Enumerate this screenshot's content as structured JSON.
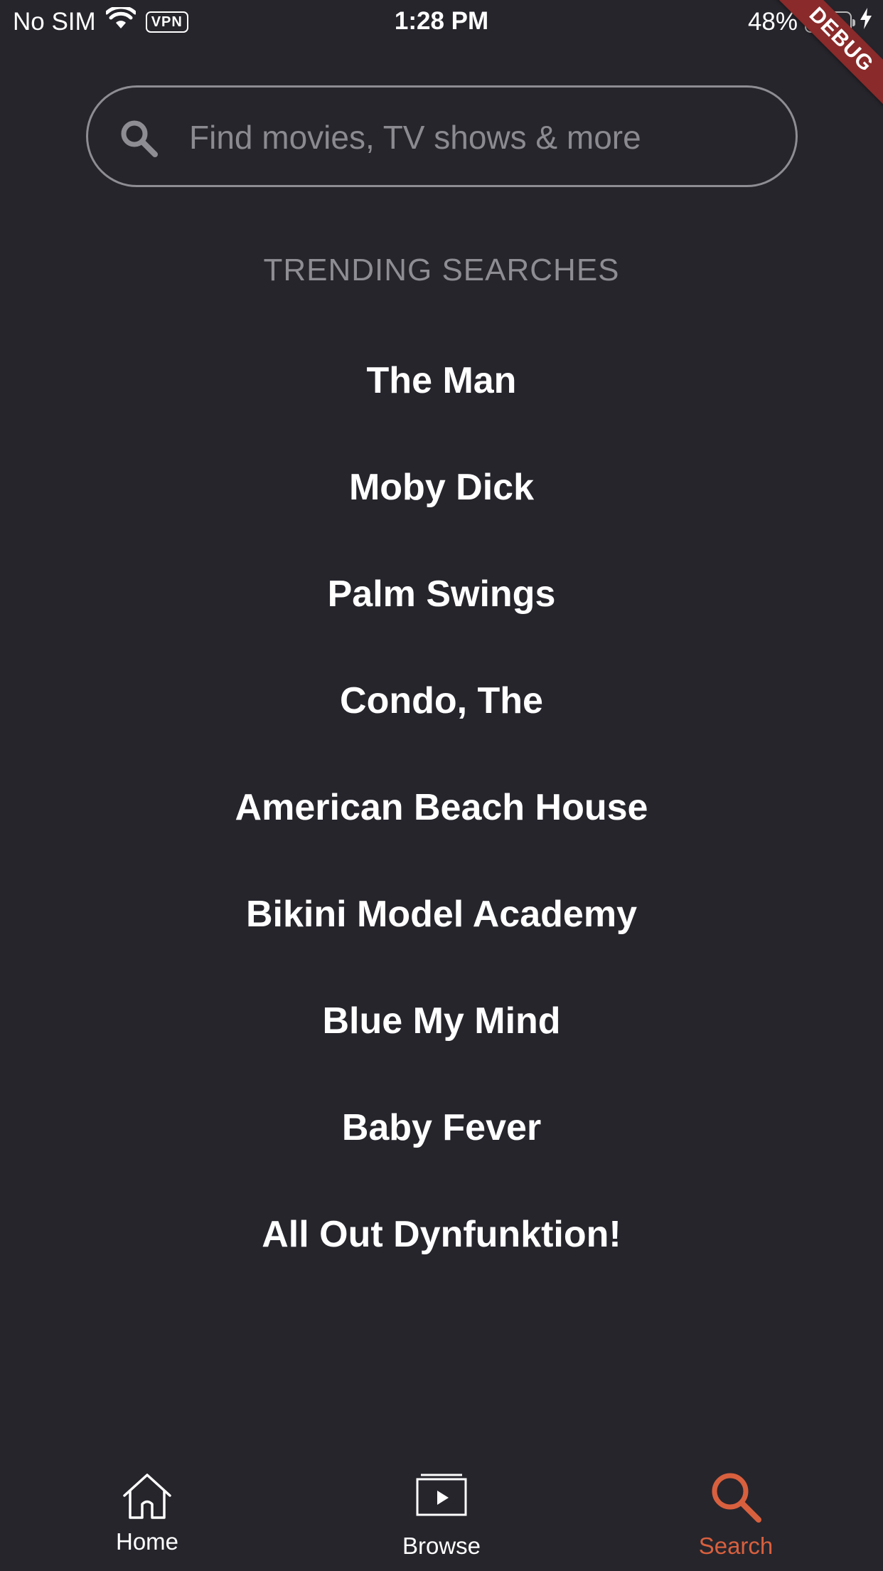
{
  "status_bar": {
    "carrier": "No SIM",
    "vpn": "VPN",
    "time": "1:28 PM",
    "battery_text": "48%",
    "battery_level": 0.48,
    "battery_color": "#5fd45b"
  },
  "debug_banner": "DEBUG",
  "search": {
    "placeholder": "Find movies, TV shows & more",
    "value": ""
  },
  "trending": {
    "header": "TRENDING SEARCHES",
    "items": [
      "The Man",
      "Moby Dick",
      "Palm Swings",
      "Condo, The",
      "American Beach House",
      "Bikini Model Academy",
      "Blue My Mind",
      "Baby Fever",
      "All Out Dynfunktion!"
    ]
  },
  "bottom_nav": {
    "items": [
      {
        "label": "Home",
        "icon": "home-icon",
        "active": false
      },
      {
        "label": "Browse",
        "icon": "browse-icon",
        "active": false
      },
      {
        "label": "Search",
        "icon": "search-icon",
        "active": true
      }
    ],
    "active_color": "#d8603e",
    "inactive_color": "#ffffff"
  },
  "colors": {
    "background": "#26252c",
    "muted_text": "#8e8d93"
  }
}
